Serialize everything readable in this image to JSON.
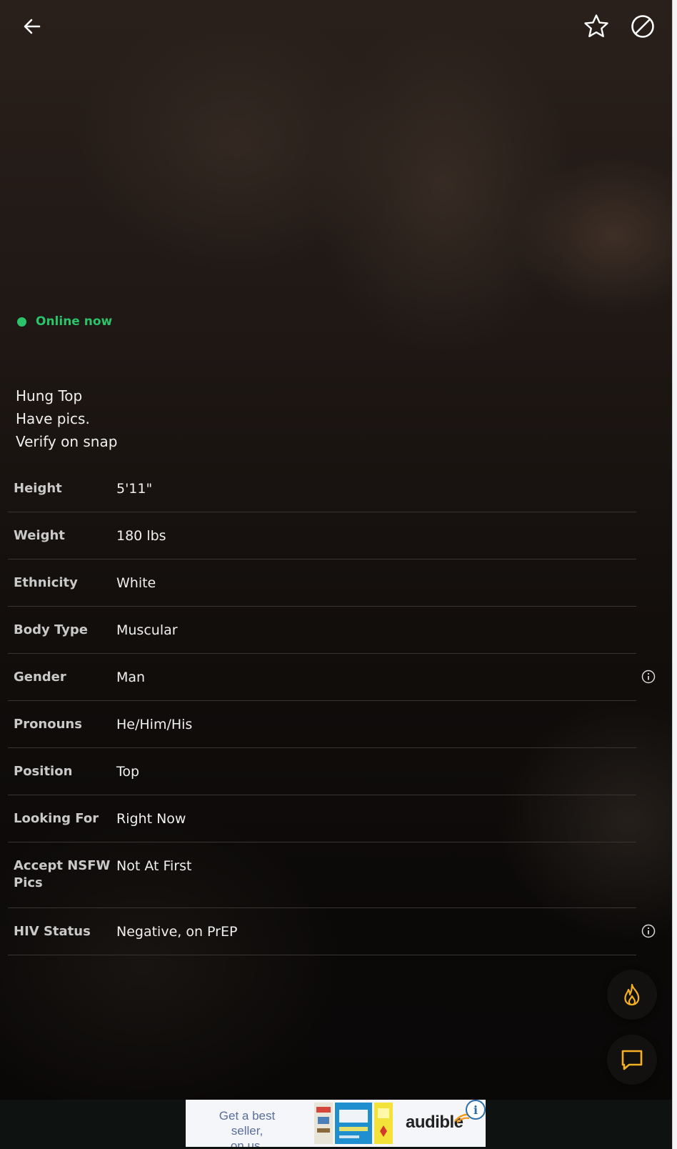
{
  "status": {
    "label": "Online now",
    "color": "#2bc46a"
  },
  "about": {
    "text": "Hung Top\nHave pics.\nVerify on snap"
  },
  "details": [
    {
      "key": "Height",
      "value": "5'11\"",
      "info": false
    },
    {
      "key": "Weight",
      "value": "180 lbs",
      "info": false
    },
    {
      "key": "Ethnicity",
      "value": "White",
      "info": false
    },
    {
      "key": "Body Type",
      "value": "Muscular",
      "info": false
    },
    {
      "key": "Gender",
      "value": "Man",
      "info": true
    },
    {
      "key": "Pronouns",
      "value": "He/Him/His",
      "info": false
    },
    {
      "key": "Position",
      "value": "Top",
      "info": false
    },
    {
      "key": "Looking For",
      "value": "Right Now",
      "info": false
    },
    {
      "key": "Accept NSFW Pics",
      "value": "Not At First",
      "info": false
    },
    {
      "key": "HIV Status",
      "value": "Negative, on PrEP",
      "info": true
    }
  ],
  "icons": {
    "back": "arrow-left-icon",
    "favorite": "star-icon",
    "block": "block-icon",
    "info": "info-icon",
    "tap": "flame-icon",
    "chat": "chat-icon"
  },
  "colors": {
    "accent": "#f5b021",
    "online": "#2bc46a"
  },
  "ad": {
    "line1": "Get a best seller,",
    "line2": "on us.",
    "brand": "audible",
    "info_label": "i"
  }
}
